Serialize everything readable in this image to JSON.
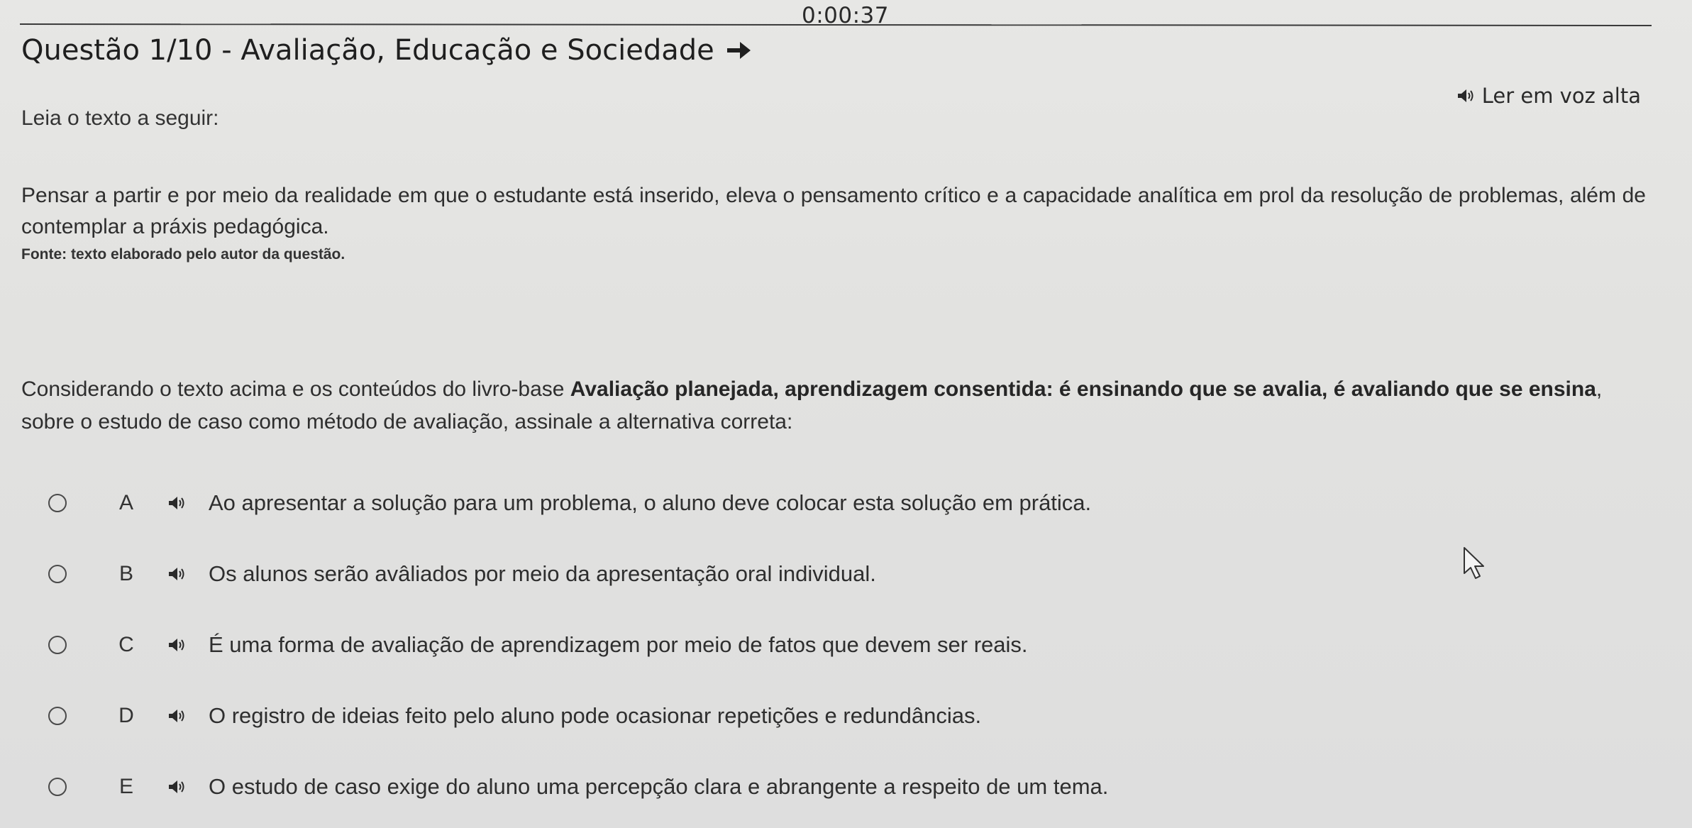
{
  "timer": "0:00:37",
  "question": {
    "title": "Questão 1/10 - Avaliação, Educação e Sociedade",
    "read_aloud_label": "Ler em voz alta",
    "intro": "Leia o texto a seguir:",
    "passage": "Pensar a partir e por meio da realidade em que o estudante está inserido, eleva o pensamento crítico e a capacidade analítica em prol da resolução de problemas, além de contemplar a práxis pedagógica.",
    "source": "Fonte: texto elaborado pelo autor da questão.",
    "prompt_start": "Considerando o texto acima e os conteúdos do livro-base ",
    "prompt_book": "Avaliação planejada, aprendizagem consentida: é ensinando que se avalia, é avaliando que se ensina",
    "prompt_end": ", sobre o estudo de caso como método de avaliação, assinale a alternativa correta:"
  },
  "options": [
    {
      "letter": "A",
      "text": "Ao apresentar a solução para um problema, o aluno deve colocar esta solução em prática."
    },
    {
      "letter": "B",
      "text": "Os alunos serão avâliados por meio da apresentação oral individual."
    },
    {
      "letter": "C",
      "text": "É uma forma de avaliação de aprendizagem por meio de fatos que devem ser reais."
    },
    {
      "letter": "D",
      "text": "O registro de ideias feito pelo aluno pode ocasionar repetições e redundâncias."
    },
    {
      "letter": "E",
      "text": "O estudo de caso exige do aluno uma percepção clara e abrangente a respeito de um tema."
    }
  ],
  "icons": {
    "speaker": "speaker-icon",
    "arrow": "arrow-right-icon",
    "cursor": "mouse-pointer-icon"
  },
  "colors": {
    "background": "#e2e2e0",
    "text": "#2e2e2e",
    "radio_border": "#4a4a4a"
  }
}
